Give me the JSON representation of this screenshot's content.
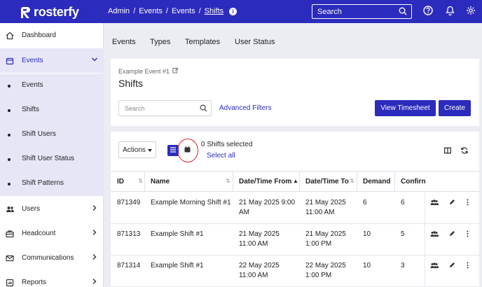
{
  "brand": {
    "name": "rosterfy"
  },
  "breadcrumb": {
    "items": [
      "Admin",
      "Events",
      "Events"
    ],
    "current": "Shifts",
    "info_icon": "info-icon"
  },
  "topbar": {
    "search_placeholder": "Search",
    "icons": [
      "help-icon",
      "bell-icon",
      "gear-icon"
    ]
  },
  "sidebar": {
    "items": [
      {
        "label": "Dashboard",
        "icon": "home-icon"
      },
      {
        "label": "Events",
        "icon": "calendar-icon"
      },
      {
        "label": "Users",
        "icon": "users-icon"
      },
      {
        "label": "Headcount",
        "icon": "briefcase-icon"
      },
      {
        "label": "Communications",
        "icon": "mail-icon"
      },
      {
        "label": "Reports",
        "icon": "chart-icon"
      }
    ],
    "sub_items": [
      "Events",
      "Shifts",
      "Shift Users",
      "Shift User Status",
      "Shift Patterns"
    ]
  },
  "tabs": [
    "Events",
    "Types",
    "Templates",
    "User Status"
  ],
  "header": {
    "eyebrow": "Example Event #1",
    "title": "Shifts",
    "search_placeholder": "Search",
    "advanced_filters": "Advanced Filters",
    "view_timesheet": "View Timesheet",
    "create": "Create"
  },
  "toolbar": {
    "actions_label": "Actions",
    "selected_text": "0 Shifts selected",
    "select_all": "Select all"
  },
  "table": {
    "columns": [
      "ID",
      "Name",
      "Date/Time From",
      "Date/Time To",
      "Demand",
      "Confirn"
    ],
    "rows": [
      {
        "id": "871349",
        "name": "Example Morning Shift #1",
        "from_1": "21 May 2025 9:00",
        "from_2": "AM",
        "to_1": "21 May 2025",
        "to_2": "11:00 AM",
        "demand": "6",
        "confirmed": "6"
      },
      {
        "id": "871313",
        "name": "Example Shift #1",
        "from_1": "21 May 2025",
        "from_2": "11:00 AM",
        "to_1": "21 May 2025",
        "to_2": "1:00 PM",
        "demand": "10",
        "confirmed": "5"
      },
      {
        "id": "871314",
        "name": "Example Shift #1",
        "from_1": "22 May 2025",
        "from_2": "11:00 AM",
        "to_1": "22 May 2025",
        "to_2": "1:00 PM",
        "demand": "10",
        "confirmed": "3"
      }
    ]
  },
  "colors": {
    "brand": "#2b2bbd",
    "annotation": "#e01d1d",
    "active_bg": "#e6e6f7"
  }
}
